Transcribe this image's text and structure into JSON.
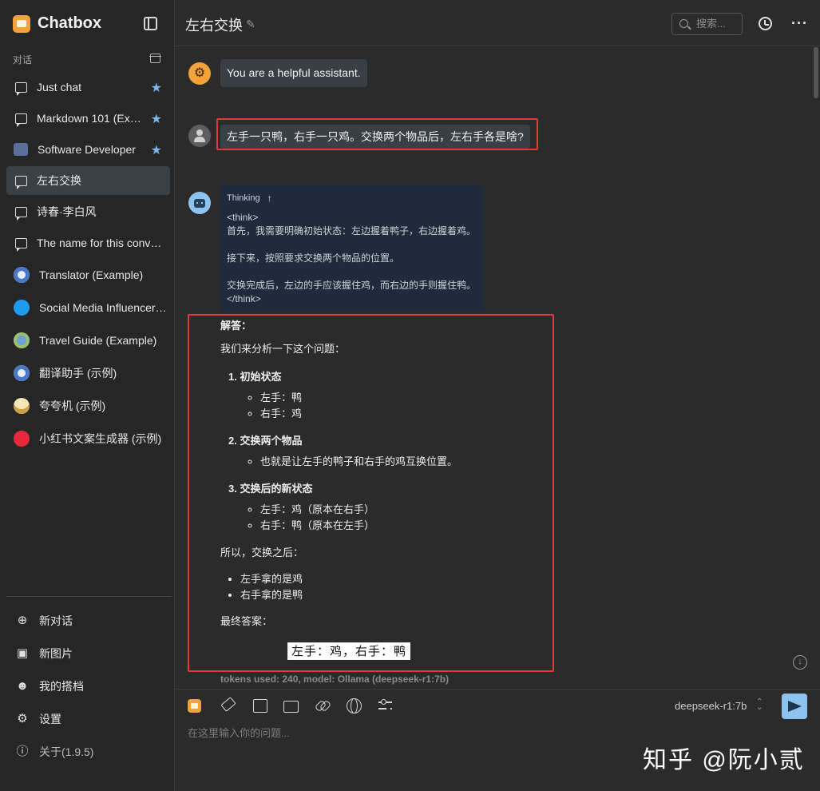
{
  "app": {
    "name": "Chatbox",
    "version_label": "关于(1.9.5)"
  },
  "sidebar": {
    "section_label": "对话",
    "conversations": [
      {
        "label": "Just chat",
        "icon": "chat-bubble-icon",
        "starred": true
      },
      {
        "label": "Markdown 101 (Example)",
        "icon": "chat-bubble-icon",
        "starred": true
      },
      {
        "label": "Software Developer",
        "icon": "developer-avatar-icon",
        "starred": true
      },
      {
        "label": "左右交换",
        "icon": "chat-bubble-icon",
        "starred": false,
        "active": true
      },
      {
        "label": "诗春·李白风",
        "icon": "chat-bubble-icon",
        "starred": false
      },
      {
        "label": "The name for this conversation",
        "icon": "chat-bubble-icon",
        "starred": false
      },
      {
        "label": "Translator (Example)",
        "icon": "translator-avatar-icon",
        "starred": false
      },
      {
        "label": "Social Media Influencer (Example)",
        "icon": "twitter-avatar-icon",
        "starred": false
      },
      {
        "label": "Travel Guide (Example)",
        "icon": "globe-avatar-icon",
        "starred": false
      },
      {
        "label": "翻译助手 (示例)",
        "icon": "translator-avatar-icon",
        "starred": false
      },
      {
        "label": "夸夸机 (示例)",
        "icon": "cheer-avatar-icon",
        "starred": false
      },
      {
        "label": "小红书文案生成器 (示例)",
        "icon": "xiaohongshu-avatar-icon",
        "starred": false
      }
    ],
    "actions": [
      {
        "label": "新对话",
        "icon": "plus-circle-icon"
      },
      {
        "label": "新图片",
        "icon": "add-image-icon"
      },
      {
        "label": "我的搭档",
        "icon": "robot-icon"
      },
      {
        "label": "设置",
        "icon": "gear-icon"
      },
      {
        "label": "关于(1.9.5)",
        "icon": "info-icon"
      }
    ]
  },
  "header": {
    "title": "左右交换",
    "search_placeholder": "搜索..."
  },
  "messages": {
    "system": "You are a helpful assistant.",
    "user": "左手一只鸭，右手一只鸡。交换两个物品后，左右手各是啥?",
    "thinking_label": "Thinking",
    "thinking_text": "<think>\n首先，我需要明确初始状态：左边握着鸭子，右边握着鸡。\n\n接下来，按照要求交换两个物品的位置。\n\n交换完成后，左边的手应该握住鸡，而右边的手则握住鸭。\n</think>",
    "answer": {
      "heading": "解答：",
      "intro": "我们来分析一下这个问题：",
      "steps": [
        {
          "title": "1. 初始状态",
          "items": [
            "左手：鸭",
            "右手：鸡"
          ]
        },
        {
          "title": "2. 交换两个物品",
          "items": [
            "也就是让左手的鸭子和右手的鸡互换位置。"
          ]
        },
        {
          "title": "3. 交换后的新状态",
          "items": [
            "左手：鸡（原本在右手）",
            "右手：鸭（原本在左手）"
          ]
        }
      ],
      "so_after": "所以，交换之后：",
      "summary": [
        "左手拿的是鸡",
        "右手拿的是鸭"
      ],
      "final_label": "最终答案：",
      "final_answer": "左手：鸡，右手：鸭"
    },
    "tokens_info": "tokens used: 240, model: Ollama (deepseek-r1:7b)"
  },
  "composer": {
    "model": "deepseek-r1:7b",
    "placeholder": "在这里输入你的问题..."
  },
  "watermark": "知乎 @阮小贰",
  "colors": {
    "accent": "#8fc3ef",
    "brand": "#f1a33a",
    "highlight_border": "#e13a3a",
    "star": "#7ab6f0"
  }
}
